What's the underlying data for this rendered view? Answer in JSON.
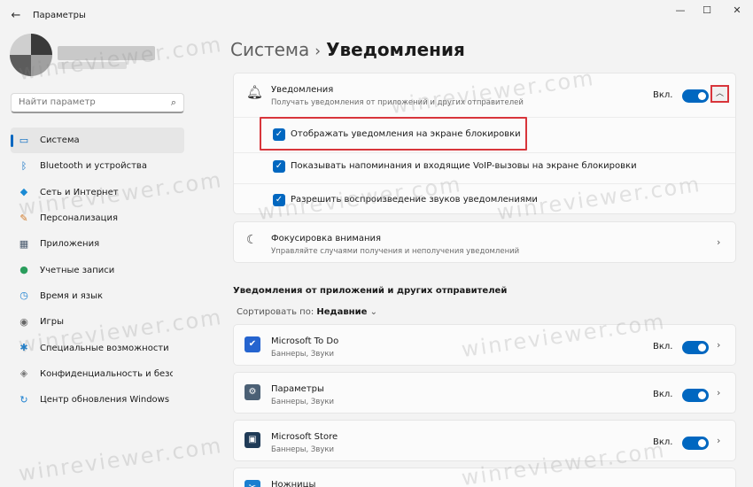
{
  "window": {
    "title": "Параметры",
    "back_icon": "arrow-left-icon",
    "minimize": "—",
    "maximize": "☐",
    "close": "✕"
  },
  "search": {
    "placeholder": "Найти параметр"
  },
  "sidebar": {
    "items": [
      {
        "label": "Система",
        "icon": "monitor-icon",
        "glyph": "▭",
        "color": "#0067c0",
        "active": true
      },
      {
        "label": "Bluetooth и устройства",
        "icon": "bluetooth-icon",
        "glyph": "ᛒ",
        "color": "#0067c0"
      },
      {
        "label": "Сеть и Интернет",
        "icon": "wifi-icon",
        "glyph": "◆",
        "color": "#1a8ad4"
      },
      {
        "label": "Персонализация",
        "icon": "brush-icon",
        "glyph": "✎",
        "color": "#d07a2b"
      },
      {
        "label": "Приложения",
        "icon": "apps-icon",
        "glyph": "▦",
        "color": "#4a5a6e"
      },
      {
        "label": "Учетные записи",
        "icon": "person-icon",
        "glyph": "●",
        "color": "#2a9d5c"
      },
      {
        "label": "Время и язык",
        "icon": "globe-clock-icon",
        "glyph": "◷",
        "color": "#1a7fd0"
      },
      {
        "label": "Игры",
        "icon": "gamepad-icon",
        "glyph": "◉",
        "color": "#666666"
      },
      {
        "label": "Специальные возможности",
        "icon": "accessibility-icon",
        "glyph": "✱",
        "color": "#1a7fd0"
      },
      {
        "label": "Конфиденциальность и безопасность",
        "icon": "shield-icon",
        "glyph": "◈",
        "color": "#777777"
      },
      {
        "label": "Центр обновления Windows",
        "icon": "update-icon",
        "glyph": "↻",
        "color": "#1a7fd0"
      }
    ]
  },
  "breadcrumb": {
    "parent": "Система",
    "separator": "›",
    "current": "Уведомления"
  },
  "notifications": {
    "title": "Уведомления",
    "description": "Получать уведомления от приложений и других отправителей",
    "state_label": "Вкл.",
    "enabled": true,
    "options": [
      {
        "label": "Отображать уведомления на экране блокировки",
        "checked": true,
        "highlighted": true
      },
      {
        "label": "Показывать напоминания и входящие VoIP-вызовы на экране блокировки",
        "checked": true
      },
      {
        "label": "Разрешить  воспроизведение звуков уведомлениями",
        "checked": true
      }
    ]
  },
  "focus": {
    "title": "Фокусировка внимания",
    "description": "Управляйте случаями получения и неполучения уведомлений"
  },
  "apps_section": {
    "heading": "Уведомления от приложений и других отправителей",
    "sort_label": "Сортировать по:",
    "sort_value": "Недавние",
    "apps": [
      {
        "name": "Microsoft To Do",
        "sub": "Баннеры, Звуки",
        "state": "Вкл.",
        "icon": "todo-check-icon",
        "glyph": "✔",
        "color": "#2564cf"
      },
      {
        "name": "Параметры",
        "sub": "Баннеры, Звуки",
        "state": "Вкл.",
        "icon": "settings-gear-icon",
        "glyph": "⚙",
        "color": "#4b6075"
      },
      {
        "name": "Microsoft Store",
        "sub": "Баннеры, Звуки",
        "state": "Вкл.",
        "icon": "store-bag-icon",
        "glyph": "▣",
        "color": "#1f3b57"
      },
      {
        "name": "Ножницы",
        "sub": "",
        "state": "",
        "icon": "scissors-icon",
        "glyph": "✂",
        "color": "#1a7fd0"
      }
    ]
  },
  "watermark": "winreviewer.com"
}
